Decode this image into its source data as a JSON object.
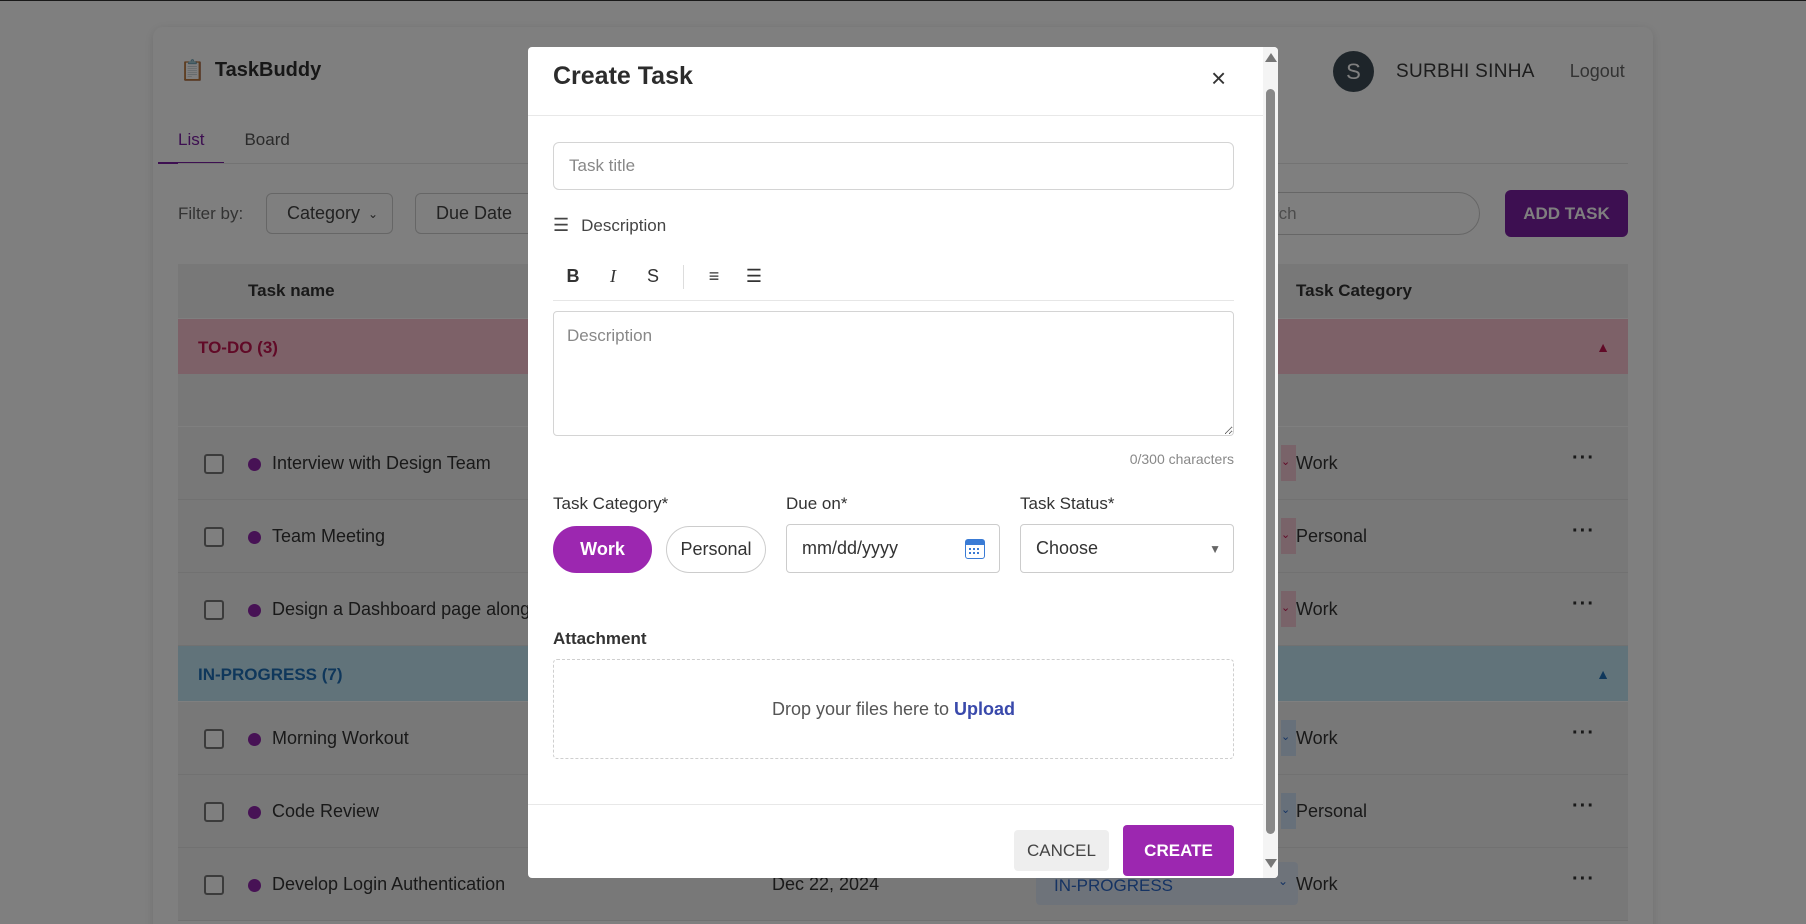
{
  "app": {
    "name": "TaskBuddy",
    "user_initial": "S",
    "user_name": "SURBHI SINHA",
    "logout_label": "Logout"
  },
  "tabs": [
    {
      "label": "List",
      "active": true
    },
    {
      "label": "Board",
      "active": false
    }
  ],
  "filters": {
    "label": "Filter by:",
    "category": "Category",
    "due_date": "Due Date",
    "search_partial": "rch",
    "add_task_label": "ADD TASK"
  },
  "table": {
    "col_task_name": "Task name",
    "col_task_category": "Task Category"
  },
  "groups": {
    "todo": {
      "label": "TO-DO (3)",
      "color": "#c2154f"
    },
    "in_progress": {
      "label": "IN-PROGRESS (7)",
      "color": "#1e6fb6"
    }
  },
  "tasks": [
    {
      "name": "Interview with Design Team",
      "category": "Work",
      "group": "todo"
    },
    {
      "name": "Team Meeting",
      "category": "Personal",
      "group": "todo"
    },
    {
      "name": "Design a Dashboard page along v",
      "category": "Work",
      "group": "todo"
    },
    {
      "name": "Morning Workout",
      "category": "Work",
      "group": "in_progress"
    },
    {
      "name": "Code Review",
      "category": "Personal",
      "group": "in_progress"
    },
    {
      "name": "Develop Login Authentication",
      "date": "Dec 22, 2024",
      "status": "IN-PROGRESS",
      "category": "Work",
      "group": "in_progress"
    }
  ],
  "modal": {
    "title": "Create Task",
    "close_glyph": "×",
    "title_placeholder": "Task title",
    "description_label": "Description",
    "toolbar": {
      "bold": "B",
      "italic": "I",
      "strike": "S",
      "ordered_list": "≡",
      "bullet_list": "☰"
    },
    "description_placeholder": "Description",
    "char_count": "0/300 characters",
    "category_label": "Task Category*",
    "category_options": [
      "Work",
      "Personal"
    ],
    "category_selected": "Work",
    "due_label": "Due on*",
    "due_placeholder": "mm/dd/yyyy",
    "status_label": "Task Status*",
    "status_value": "Choose",
    "attachment_label": "Attachment",
    "drop_text": "Drop your files here to",
    "upload_link": "Upload",
    "cancel_label": "CANCEL",
    "create_label": "CREATE"
  },
  "colors": {
    "brand_purple": "#9c27b0",
    "todo_bg": "#fac3d1",
    "progress_bg": "#c2e6f5"
  },
  "icons": {
    "logo": "clipboard-icon",
    "close": "close-icon",
    "description": "menu-icon",
    "due": "calendar-icon"
  }
}
